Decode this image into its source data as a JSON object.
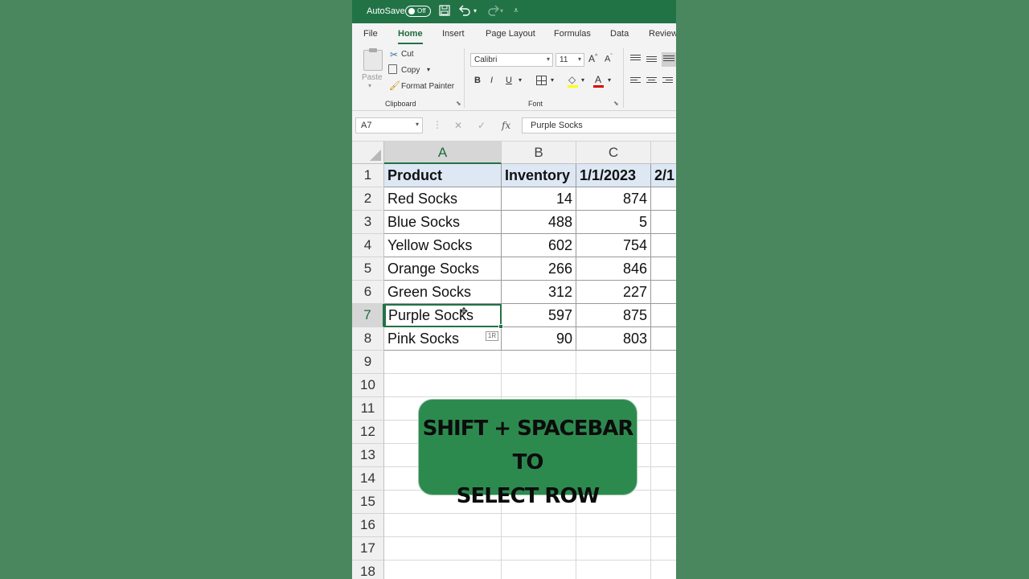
{
  "titlebar": {
    "autosave_label": "AutoSave",
    "toggle_state": "Off",
    "icons": [
      "save-icon",
      "undo-icon",
      "redo-icon",
      "customize-qat-icon"
    ]
  },
  "menu": {
    "tabs": [
      "File",
      "Home",
      "Insert",
      "Page Layout",
      "Formulas",
      "Data",
      "Review"
    ],
    "active_tab": "Home"
  },
  "ribbon": {
    "clipboard": {
      "paste_label": "Paste",
      "cut_label": "Cut",
      "copy_label": "Copy",
      "format_painter_label": "Format Painter",
      "group_label": "Clipboard"
    },
    "font": {
      "font_name": "Calibri",
      "font_size": "11",
      "bold": "B",
      "italic": "I",
      "underline": "U",
      "group_label": "Font"
    }
  },
  "formula_bar": {
    "name_box": "A7",
    "cancel_glyph": "✕",
    "enter_glyph": "✓",
    "fx_label": "fx",
    "formula_value": "Purple Socks"
  },
  "grid": {
    "columns": [
      "A",
      "B",
      "C"
    ],
    "partial_column_header": "",
    "rows": [
      "1",
      "2",
      "3",
      "4",
      "5",
      "6",
      "7",
      "8",
      "9",
      "10",
      "11",
      "12",
      "13",
      "14",
      "15",
      "16",
      "17",
      "18"
    ],
    "header_row": [
      "Product",
      "Inventory",
      "1/1/2023",
      "2/1"
    ],
    "data_rows": [
      [
        "Red Socks",
        "14",
        "874"
      ],
      [
        "Blue Socks",
        "488",
        "5"
      ],
      [
        "Yellow Socks",
        "602",
        "754"
      ],
      [
        "Orange Socks",
        "266",
        "846"
      ],
      [
        "Green Socks",
        "312",
        "227"
      ],
      [
        "Purple Socks",
        "597",
        "875"
      ],
      [
        "Pink Socks",
        "90",
        "803"
      ]
    ],
    "selected_cell": "A7",
    "quick_analysis_label": "1R"
  },
  "overlay": {
    "line1": "SHIFT + SPACEBAR TO",
    "line2": "SELECT ROW"
  },
  "colors": {
    "excel_green": "#217346",
    "background": "#4a875e",
    "banner": "#2d8a4e",
    "header_fill": "#dde8f4"
  }
}
